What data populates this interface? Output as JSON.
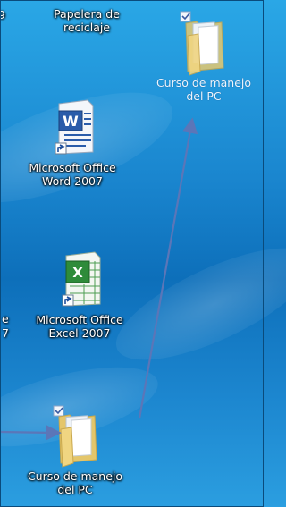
{
  "desktop": {
    "icons": [
      {
        "id": "recycle",
        "label": "Papelera de\nreciclaje"
      },
      {
        "id": "word",
        "label": "Microsoft Office\nWord 2007"
      },
      {
        "id": "excel",
        "label": "Microsoft Office\nExcel 2007"
      },
      {
        "id": "folder-dest",
        "label": "Curso de manejo\ndel PC"
      },
      {
        "id": "folder-src",
        "label": "Curso de manejo\ndel PC"
      }
    ],
    "partial_left_labels": [
      "9",
      "e",
      "7"
    ]
  },
  "colors": {
    "wallpaper_top": "#2aa7e6",
    "wallpaper_mid": "#0d6fba",
    "arrow": "#5b76b8",
    "word_blue": "#2a5caa",
    "excel_green": "#2e8b3a",
    "folder_yellow": "#f2d27a"
  }
}
